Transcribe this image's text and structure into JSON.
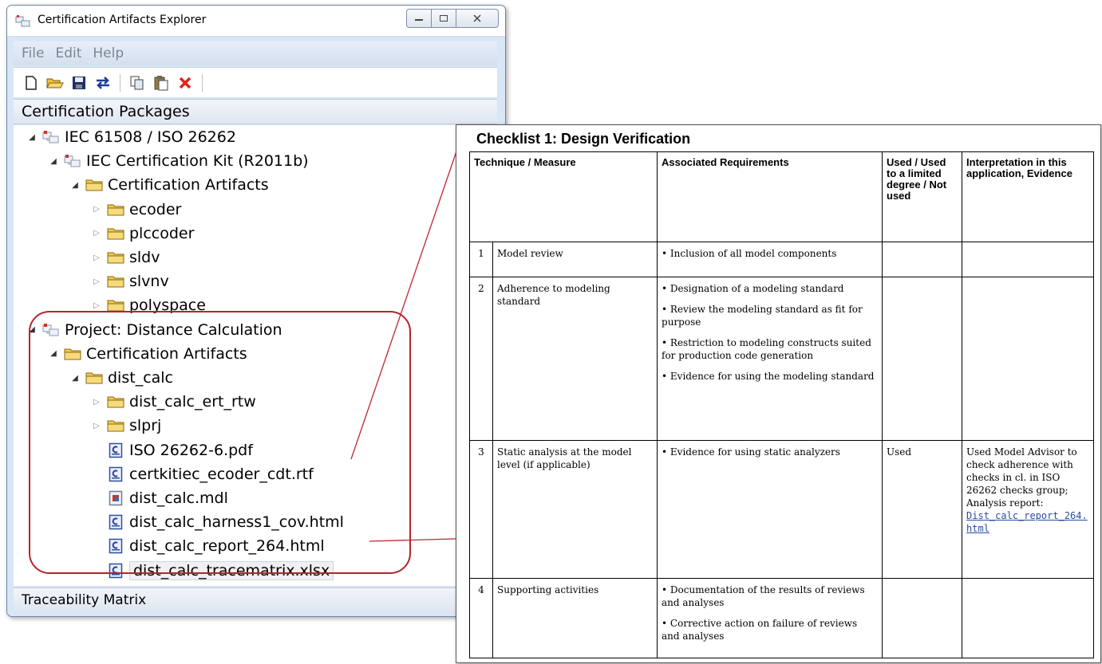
{
  "window": {
    "title": "Certification Artifacts Explorer",
    "menu": [
      "File",
      "Edit",
      "Help"
    ],
    "section_header": "Certification Packages",
    "bottom_header": "Traceability Matrix"
  },
  "tree": [
    {
      "label": "IEC 61508 / ISO 26262",
      "icon": "package-icon",
      "arrow": "expanded",
      "level": 0
    },
    {
      "label": "IEC Certification Kit (R2011b)",
      "icon": "package-icon",
      "arrow": "expanded",
      "level": 1
    },
    {
      "label": "Certification Artifacts",
      "icon": "folder-icon",
      "arrow": "expanded",
      "level": 2
    },
    {
      "label": "ecoder",
      "icon": "folder-icon",
      "arrow": "collapsed",
      "level": 3
    },
    {
      "label": "plccoder",
      "icon": "folder-icon",
      "arrow": "collapsed",
      "level": 3
    },
    {
      "label": "sldv",
      "icon": "folder-icon",
      "arrow": "collapsed",
      "level": 3
    },
    {
      "label": "slvnv",
      "icon": "folder-icon",
      "arrow": "collapsed",
      "level": 3
    },
    {
      "label": "polyspace",
      "icon": "folder-icon",
      "arrow": "collapsed",
      "level": 3
    },
    {
      "label": "Project: Distance Calculation",
      "icon": "package-icon",
      "arrow": "expanded",
      "level": 0
    },
    {
      "label": "Certification Artifacts",
      "icon": "folder-icon",
      "arrow": "expanded",
      "level": 1
    },
    {
      "label": "dist_calc",
      "icon": "folder-icon",
      "arrow": "expanded",
      "level": 2
    },
    {
      "label": "dist_calc_ert_rtw",
      "icon": "folder-icon",
      "arrow": "collapsed",
      "level": 3
    },
    {
      "label": "slprj",
      "icon": "folder-icon",
      "arrow": "collapsed",
      "level": 3
    },
    {
      "label": "ISO 26262-6.pdf",
      "icon": "document-icon",
      "arrow": "none",
      "level": 3
    },
    {
      "label": "certkitiec_ecoder_cdt.rtf",
      "icon": "document-icon",
      "arrow": "none",
      "level": 3
    },
    {
      "label": "dist_calc.mdl",
      "icon": "model-file-icon",
      "arrow": "none",
      "level": 3
    },
    {
      "label": "dist_calc_harness1_cov.html",
      "icon": "document-icon",
      "arrow": "none",
      "level": 3
    },
    {
      "label": "dist_calc_report_264.html",
      "icon": "document-icon",
      "arrow": "none",
      "level": 3
    },
    {
      "label": "dist_calc_tracematrix.xlsx",
      "icon": "document-icon",
      "arrow": "none",
      "level": 3,
      "selected": true
    }
  ],
  "toolbar": [
    "new-file-icon",
    "open-folder-icon",
    "save-icon",
    "sync-icon",
    "copy-icon",
    "paste-icon",
    "delete-icon"
  ],
  "checklist": {
    "title": "Checklist 1: Design Verification",
    "headers": {
      "technique": "Technique / Measure",
      "requirements": "Associated Requirements",
      "used": "Used / Used to a limited degree / Not used",
      "interpretation": "Interpretation in this application, Evidence"
    },
    "rows": [
      {
        "num": "1",
        "technique": "Model review",
        "requirements": [
          "Inclusion of all model components"
        ],
        "used": "",
        "interpretation": "",
        "link": ""
      },
      {
        "num": "2",
        "technique": "Adherence to modeling standard",
        "requirements": [
          "Designation of a modeling standard",
          "Review the modeling standard as fit for purpose",
          "Restriction to modeling constructs suited for production code generation",
          "Evidence for using the modeling standard"
        ],
        "used": "",
        "interpretation": "",
        "link": ""
      },
      {
        "num": "3",
        "technique": "Static analysis at the model level (if applicable)",
        "requirements": [
          "Evidence for using static analyzers"
        ],
        "used": "Used",
        "interpretation": "Used Model Advisor to check adherence with checks in cl. in ISO 26262 checks group; Analysis report:",
        "link": "Dist_calc_report_264.html"
      },
      {
        "num": "4",
        "technique": "Supporting activities",
        "requirements": [
          "Documentation of the results of reviews and analyses",
          "Corrective action on failure of reviews and analyses"
        ],
        "used": "",
        "interpretation": "",
        "link": ""
      }
    ]
  },
  "colors": {
    "highlight": "#b3262b",
    "evidence_text": "#2a4c9e",
    "folder": "#f2c94c",
    "window_frame": "#d8e6f6"
  }
}
